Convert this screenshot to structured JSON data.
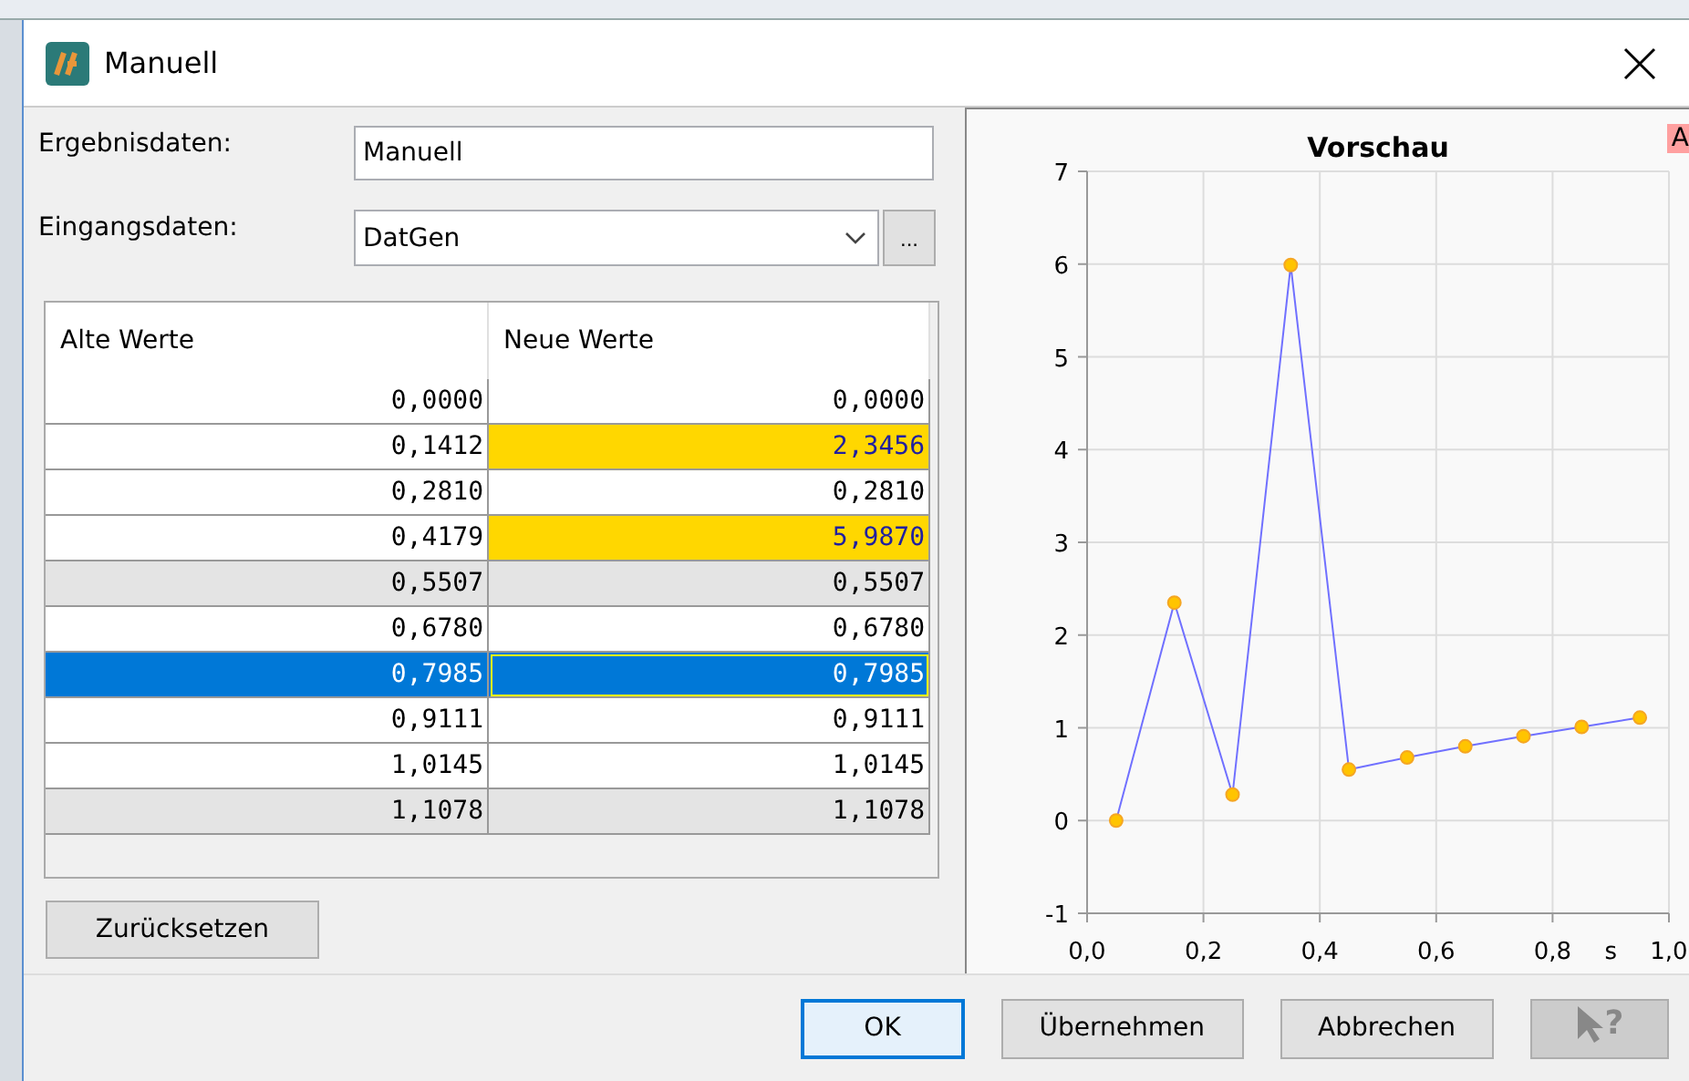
{
  "window": {
    "title": "Manuell"
  },
  "form": {
    "result": {
      "label": "Ergebnisdaten:",
      "value": "Manuell"
    },
    "input": {
      "label": "Eingangsdaten:",
      "value": "DatGen",
      "browse": "..."
    }
  },
  "table": {
    "columns": [
      "Alte Werte",
      "Neue Werte"
    ],
    "rows": [
      {
        "old": "0,0000",
        "new": "0,0000",
        "modified": false,
        "selected": false,
        "shaded": false
      },
      {
        "old": "0,1412",
        "new": "2,3456",
        "modified": true,
        "selected": false,
        "shaded": false
      },
      {
        "old": "0,2810",
        "new": "0,2810",
        "modified": false,
        "selected": false,
        "shaded": false
      },
      {
        "old": "0,4179",
        "new": "5,9870",
        "modified": true,
        "selected": false,
        "shaded": false
      },
      {
        "old": "0,5507",
        "new": "0,5507",
        "modified": false,
        "selected": false,
        "shaded": true
      },
      {
        "old": "0,6780",
        "new": "0,6780",
        "modified": false,
        "selected": false,
        "shaded": false
      },
      {
        "old": "0,7985",
        "new": "0,7985",
        "modified": false,
        "selected": true,
        "shaded": false
      },
      {
        "old": "0,9111",
        "new": "0,9111",
        "modified": false,
        "selected": false,
        "shaded": false
      },
      {
        "old": "1,0145",
        "new": "1,0145",
        "modified": false,
        "selected": false,
        "shaded": false
      },
      {
        "old": "1,1078",
        "new": "1,1078",
        "modified": false,
        "selected": false,
        "shaded": true
      }
    ]
  },
  "reset_button": "Zurücksetzen",
  "preview": {
    "badge": "A",
    "chart_data": {
      "type": "line",
      "title": "Vorschau",
      "xlabel": "s",
      "x": [
        0.05,
        0.15,
        0.25,
        0.35,
        0.45,
        0.55,
        0.65,
        0.75,
        0.85,
        0.95
      ],
      "series": [
        {
          "color": "#7070ff",
          "marker": "circle",
          "values": [
            0,
            2.35,
            0.28,
            5.99,
            0.55,
            0.68,
            0.8,
            0.91,
            1.01,
            1.11
          ]
        }
      ],
      "grid": true,
      "xlim": [
        0,
        1
      ],
      "ylim": [
        -1,
        7
      ],
      "xticks": [
        {
          "value": 0,
          "label": "0,0"
        },
        {
          "value": 0.2,
          "label": "0,2"
        },
        {
          "value": 0.4,
          "label": "0,4"
        },
        {
          "value": 0.6,
          "label": "0,6"
        },
        {
          "value": 0.8,
          "label": "0,8"
        },
        {
          "value": 1,
          "label": "1,0"
        }
      ],
      "yticks": [
        -1,
        0,
        1,
        2,
        3,
        4,
        5,
        6,
        7
      ]
    }
  },
  "buttons": [
    {
      "label": "OK",
      "kind": "default"
    },
    {
      "label": "Übernehmen",
      "kind": "normal"
    },
    {
      "label": "Abbrechen",
      "kind": "normal"
    },
    {
      "kind": "help",
      "label": "?",
      "disabled": true
    }
  ]
}
